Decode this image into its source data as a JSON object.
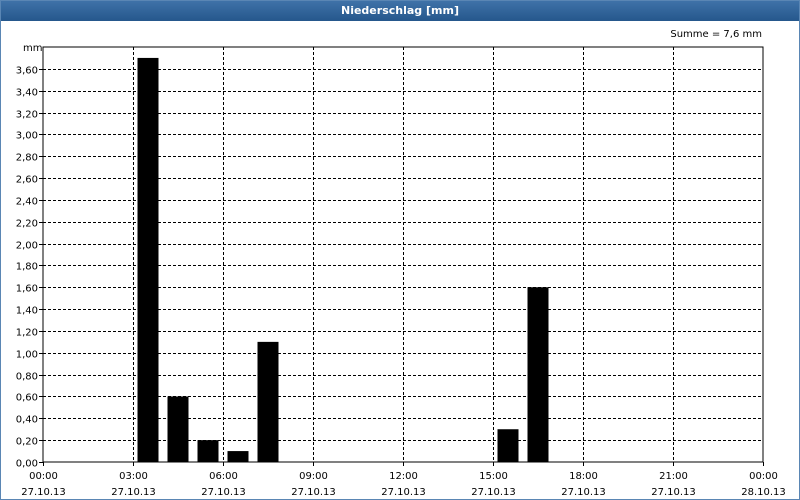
{
  "window": {
    "title": "Niederschlag [mm]"
  },
  "chart_data": {
    "type": "bar",
    "title": "Niederschlag [mm]",
    "ylabel": "mm",
    "ylim": [
      0,
      3.8
    ],
    "grid": true,
    "summary": "Summe = 7,6 mm",
    "x_ticks": [
      {
        "x": 0,
        "time": "00:00",
        "date": "27.10.13"
      },
      {
        "x": 3,
        "time": "03:00",
        "date": "27.10.13"
      },
      {
        "x": 6,
        "time": "06:00",
        "date": "27.10.13"
      },
      {
        "x": 9,
        "time": "09:00",
        "date": "27.10.13"
      },
      {
        "x": 12,
        "time": "12:00",
        "date": "27.10.13"
      },
      {
        "x": 15,
        "time": "15:00",
        "date": "27.10.13"
      },
      {
        "x": 18,
        "time": "18:00",
        "date": "27.10.13"
      },
      {
        "x": 21,
        "time": "21:00",
        "date": "27.10.13"
      },
      {
        "x": 24,
        "time": "00:00",
        "date": "28.10.13"
      }
    ],
    "y_ticks": [
      "0,00",
      "0,20",
      "0,40",
      "0,60",
      "0,80",
      "1,00",
      "1,20",
      "1,40",
      "1,60",
      "1,80",
      "2,00",
      "2,20",
      "2,40",
      "2,60",
      "2,80",
      "3,00",
      "3,20",
      "3,40",
      "3,60"
    ],
    "hours": [
      3,
      4,
      5,
      6,
      7,
      8,
      9,
      10,
      11,
      12,
      13,
      14,
      15,
      16
    ],
    "values": [
      3.7,
      0.6,
      0.2,
      0.1,
      1.1,
      0,
      0,
      0,
      0,
      0,
      0,
      0,
      0.3,
      1.6
    ]
  }
}
